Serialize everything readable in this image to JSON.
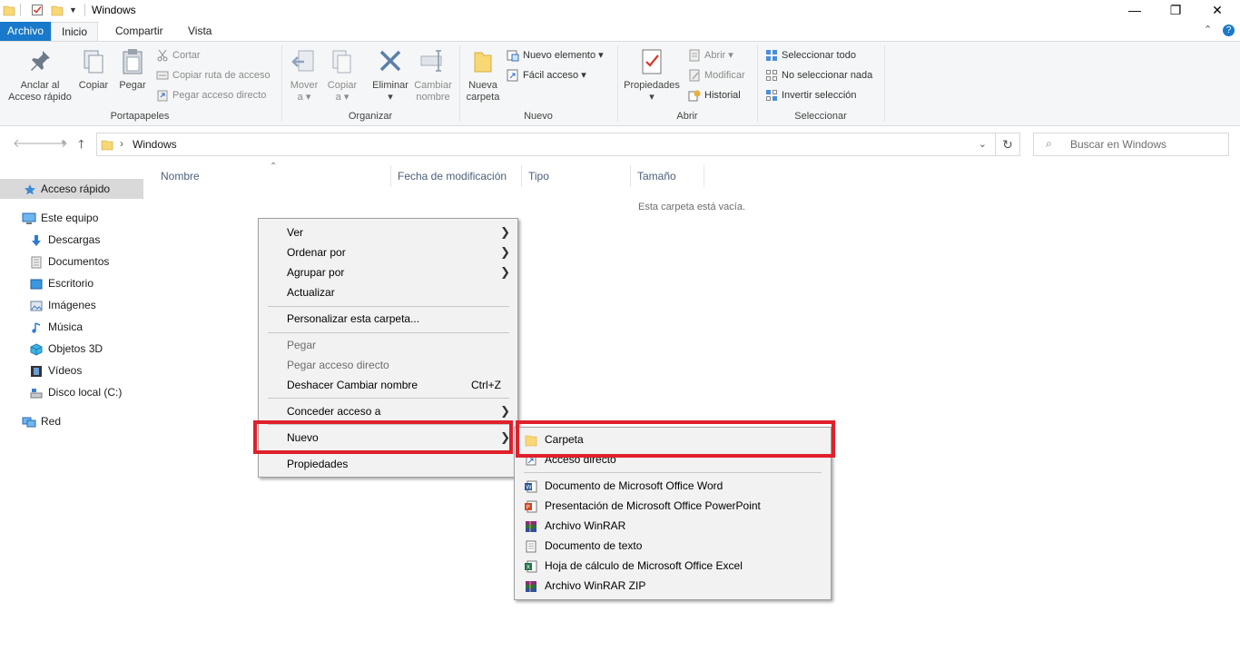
{
  "window": {
    "title": "Windows",
    "minimize": "—",
    "maximize": "❐",
    "close": "✕"
  },
  "ribbon_tabs": {
    "file": "Archivo",
    "home": "Inicio",
    "share": "Compartir",
    "view": "Vista"
  },
  "ribbon": {
    "pin_line1": "Anclar al",
    "pin_line2": "Acceso rápido",
    "copy": "Copiar",
    "paste": "Pegar",
    "cut": "Cortar",
    "copy_path": "Copiar ruta de acceso",
    "paste_shortcut": "Pegar acceso directo",
    "group_clipboard": "Portapapeles",
    "move_to_line1": "Mover",
    "move_to_line2": "a ▾",
    "copy_to_line1": "Copiar",
    "copy_to_line2": "a ▾",
    "delete": "Eliminar",
    "delete_arrow": "▾",
    "rename_line1": "Cambiar",
    "rename_line2": "nombre",
    "group_organize": "Organizar",
    "new_folder_line1": "Nueva",
    "new_folder_line2": "carpeta",
    "new_item": "Nuevo elemento ▾",
    "easy_access": "Fácil acceso ▾",
    "group_new": "Nuevo",
    "properties": "Propiedades",
    "properties_arrow": "▾",
    "open": "Abrir ▾",
    "edit": "Modificar",
    "history": "Historial",
    "group_open": "Abrir",
    "select_all": "Seleccionar todo",
    "select_none": "No seleccionar nada",
    "invert_selection": "Invertir selección",
    "group_select": "Seleccionar"
  },
  "address": {
    "path": "Windows",
    "search_placeholder": "Buscar en Windows"
  },
  "nav": {
    "quick_access": "Acceso rápido",
    "this_pc": "Este equipo",
    "downloads": "Descargas",
    "documents": "Documentos",
    "desktop": "Escritorio",
    "pictures": "Imágenes",
    "music": "Música",
    "objects3d": "Objetos 3D",
    "videos": "Vídeos",
    "local_disk": "Disco local (C:)",
    "network": "Red"
  },
  "columns": {
    "name": "Nombre",
    "modified": "Fecha de modificación",
    "type": "Tipo",
    "size": "Tamaño"
  },
  "empty_message": "Esta carpeta está vacía.",
  "context_menu": {
    "view": "Ver",
    "sort_by": "Ordenar por",
    "group_by": "Agrupar por",
    "refresh": "Actualizar",
    "customize": "Personalizar esta carpeta...",
    "paste": "Pegar",
    "paste_shortcut": "Pegar acceso directo",
    "undo_rename": "Deshacer Cambiar nombre",
    "undo_shortcut": "Ctrl+Z",
    "give_access": "Conceder acceso a",
    "new": "Nuevo",
    "properties": "Propiedades"
  },
  "submenu": {
    "folder": "Carpeta",
    "shortcut": "Acceso directo",
    "word": "Documento de Microsoft Office Word",
    "powerpoint": "Presentación de Microsoft Office PowerPoint",
    "winrar": "Archivo WinRAR",
    "text": "Documento de texto",
    "excel": "Hoja de cálculo de Microsoft Office Excel",
    "winrar_zip": "Archivo WinRAR ZIP"
  },
  "colors": {
    "file_tab": "#1979ca",
    "highlight": "#e0202a",
    "folder": "#f8d775"
  }
}
